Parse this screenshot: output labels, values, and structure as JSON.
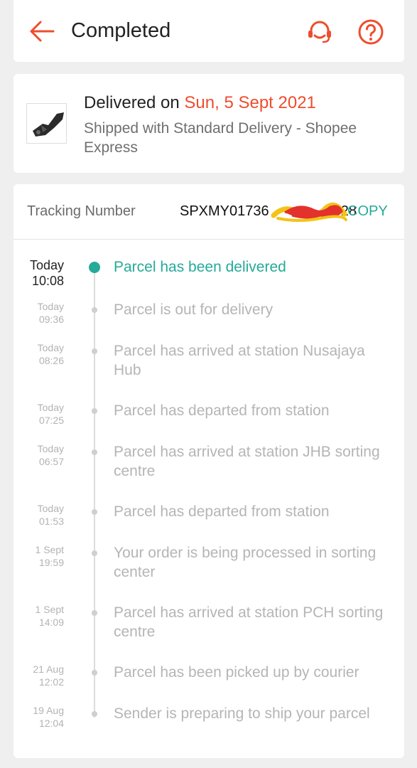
{
  "header": {
    "title": "Completed",
    "icons": {
      "back": "back-arrow-icon",
      "support": "headset-icon",
      "help": "question-mark-icon"
    },
    "accent_color": "#ee4d2d"
  },
  "delivery": {
    "delivered_prefix": "Delivered on ",
    "delivered_date": "Sun, 5 Sept 2021",
    "shipped_text": "Shipped with Standard Delivery  - Shopee Express"
  },
  "tracking": {
    "label": "Tracking Number",
    "number": "SPXMY01736",
    "number_suffix": "028",
    "copy_label": "COPY",
    "copy_color": "#26aa99"
  },
  "events": [
    {
      "day": "Today",
      "time": "10:08",
      "text": "Parcel has been delivered",
      "active": true
    },
    {
      "day": "Today",
      "time": "09:36",
      "text": "Parcel is out for delivery"
    },
    {
      "day": "Today",
      "time": "08:26",
      "text": "Parcel has arrived at station Nusajaya Hub"
    },
    {
      "day": "Today",
      "time": "07:25",
      "text": "Parcel has departed from station"
    },
    {
      "day": "Today",
      "time": "06:57",
      "text": "Parcel has arrived at station JHB sorting centre"
    },
    {
      "day": "Today",
      "time": "01:53",
      "text": "Parcel has departed from station"
    },
    {
      "day": "1 Sept",
      "time": "19:59",
      "text": "Your order is being processed in sorting center"
    },
    {
      "day": "1 Sept",
      "time": "14:09",
      "text": "Parcel has arrived at station PCH sorting centre"
    },
    {
      "day": "21 Aug",
      "time": "12:02",
      "text": "Parcel has been picked up by courier"
    },
    {
      "day": "19 Aug",
      "time": "12:04",
      "text": "Sender is preparing to ship your parcel"
    }
  ]
}
